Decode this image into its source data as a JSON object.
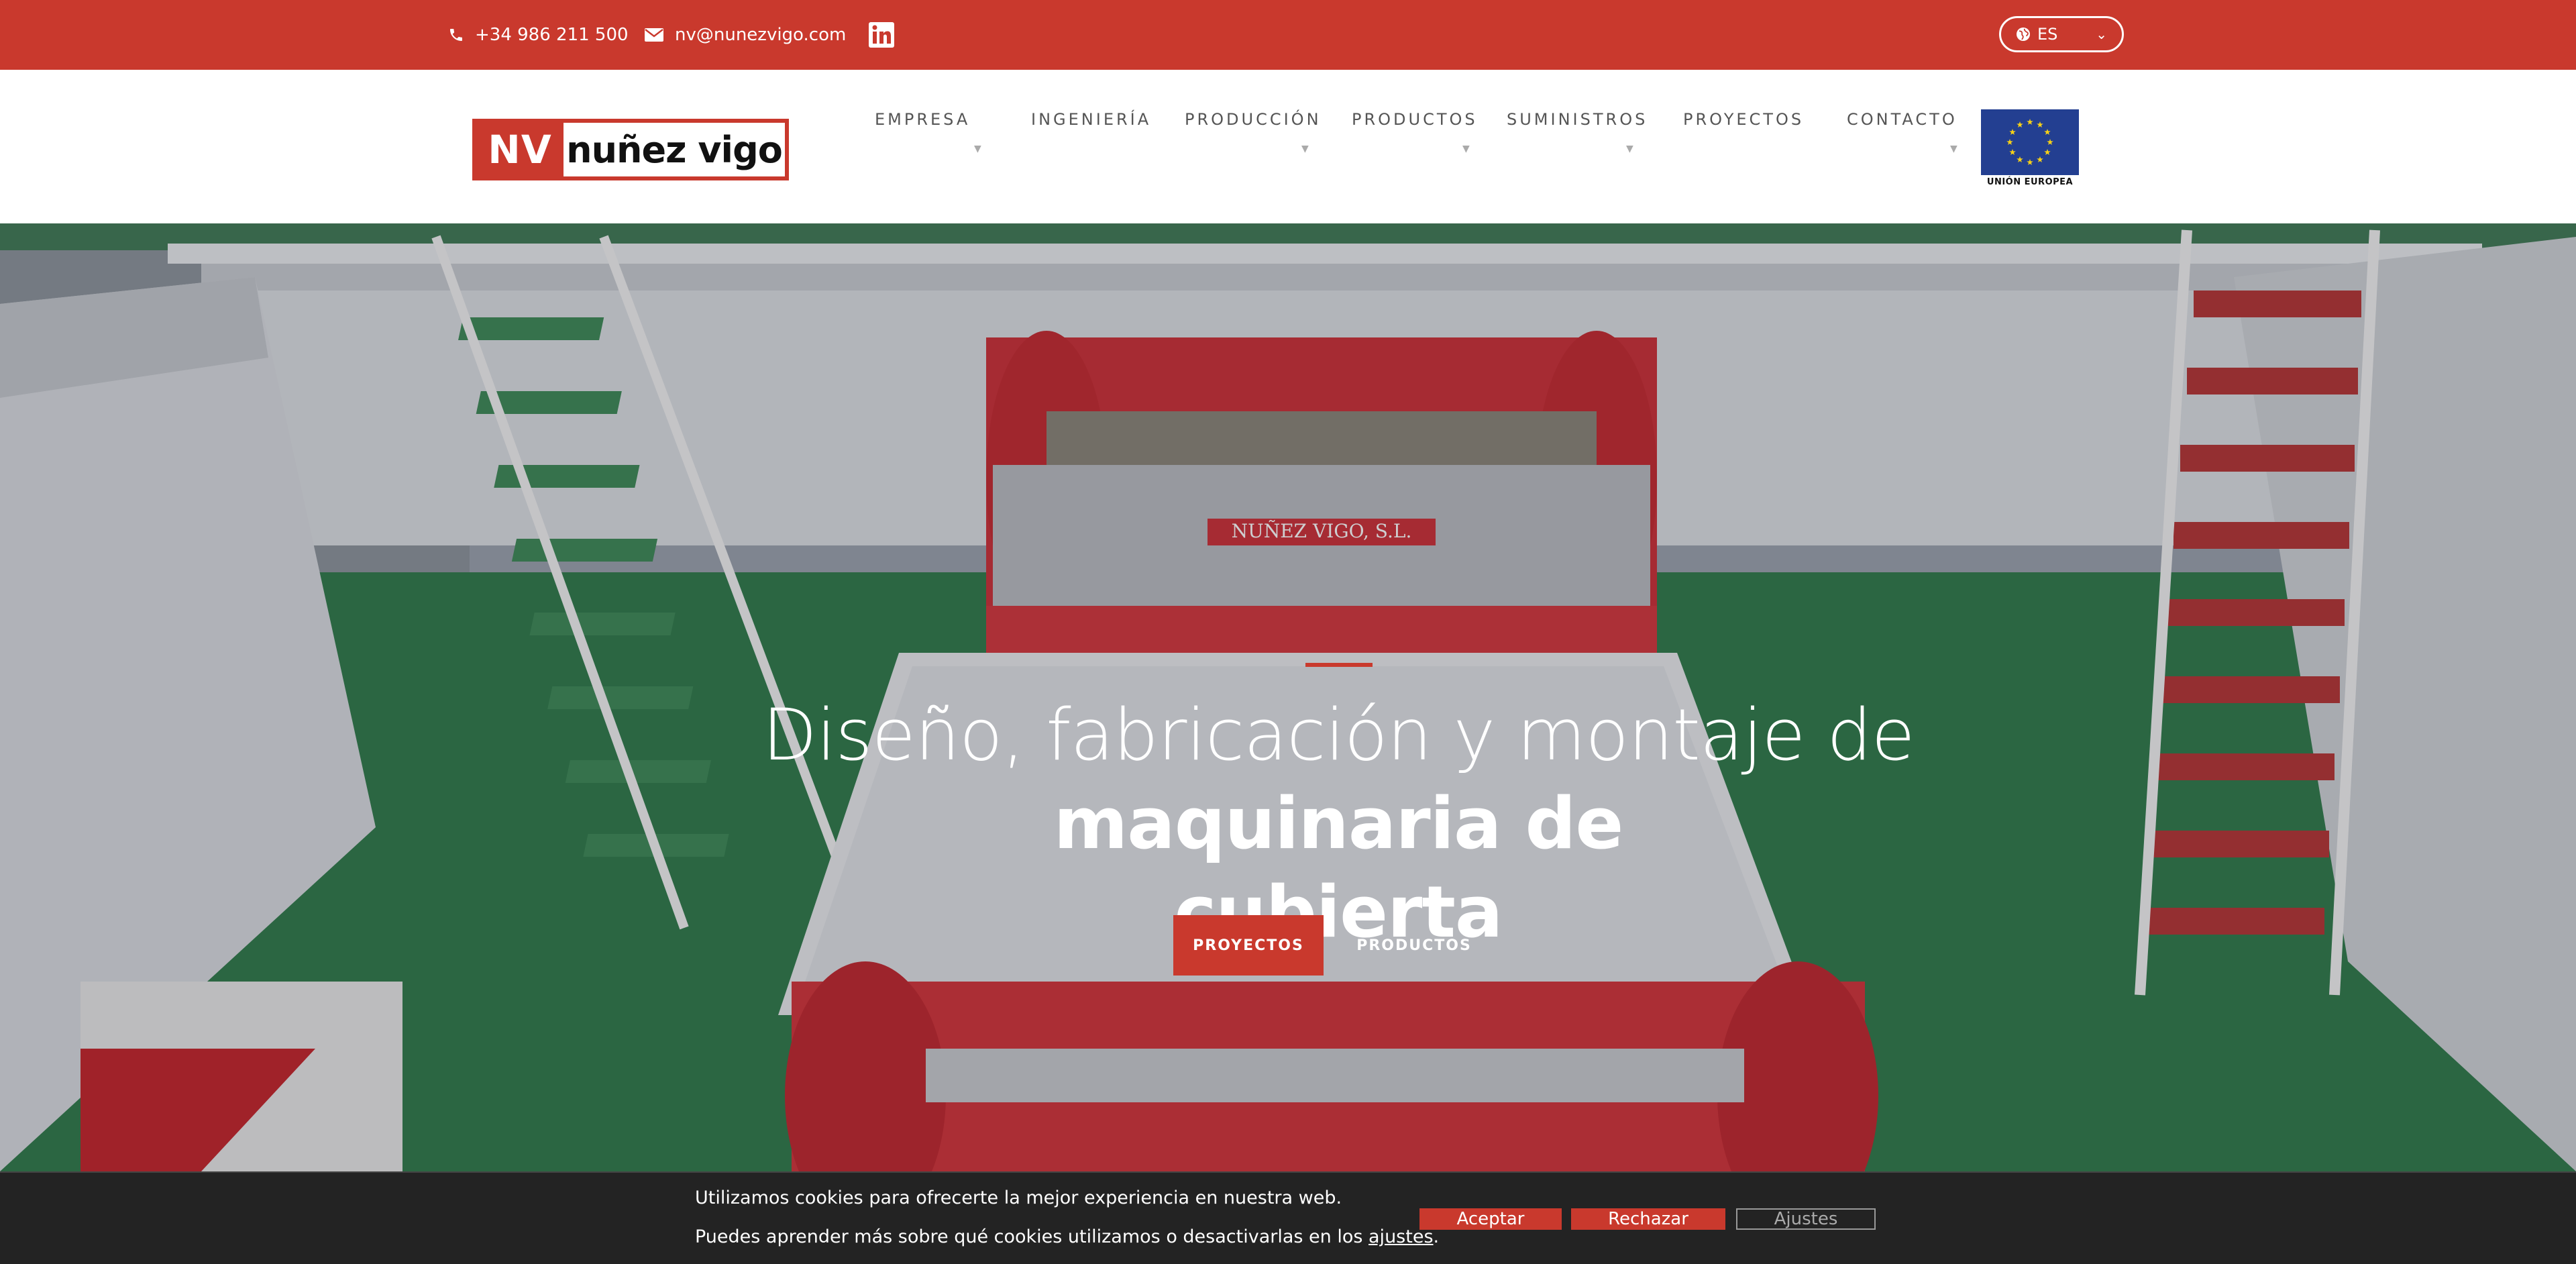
{
  "topbar": {
    "phone": "+34 986 211 500",
    "email": "nv@nunezvigo.com",
    "social": "linkedin-icon",
    "language": "ES"
  },
  "header": {
    "logo_mark": "NV",
    "logo_text": "nuñez vigo",
    "nav": [
      {
        "label": "EMPRESA",
        "has_dropdown": true
      },
      {
        "label": "INGENIERÍA",
        "has_dropdown": false
      },
      {
        "label": "PRODUCCIÓN",
        "has_dropdown": true
      },
      {
        "label": "PRODUCTOS",
        "has_dropdown": true
      },
      {
        "label": "SUMINISTROS",
        "has_dropdown": true
      },
      {
        "label": "PROYECTOS",
        "has_dropdown": false
      },
      {
        "label": "CONTACTO",
        "has_dropdown": true
      }
    ],
    "eu_label": "UNIÓN EUROPEA"
  },
  "hero": {
    "headline_light": "Diseño, fabricación y montaje de",
    "headline_bold_1": "maquinaria de",
    "headline_bold_2": "cubierta",
    "plate_text": "NUÑEZ VIGO, S.L.",
    "primary_button": "PROYECTOS",
    "secondary_button": "PRODUCTOS"
  },
  "cookie_bar": {
    "line1": "Utilizamos cookies para ofrecerte la mejor experiencia en nuestra web.",
    "line2_prefix": "Puedes aprender más sobre qué cookies utilizamos o desactivarlas en los ",
    "line2_link": "ajustes",
    "line2_suffix": ".",
    "accept": "Aceptar",
    "reject": "Rechazar",
    "settings": "Ajustes"
  },
  "colors": {
    "brand_red": "#c9392d",
    "eu_blue": "#233f91",
    "eu_star": "#f7d117",
    "deck_green": "#2f7a4a",
    "cookie_bg": "#232323"
  }
}
